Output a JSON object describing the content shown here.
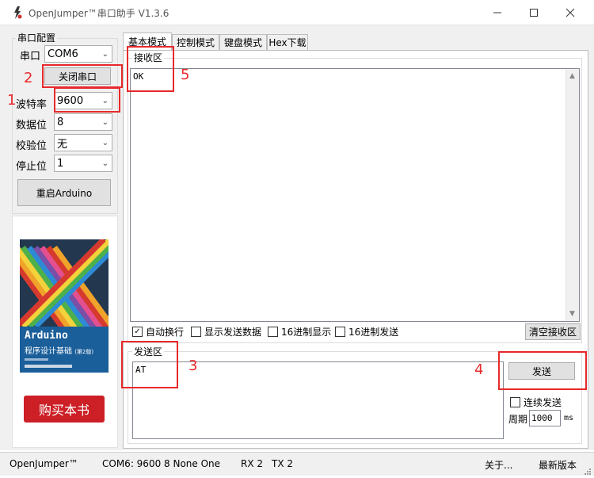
{
  "window": {
    "title": "OpenJumper™串口助手  V1.3.6",
    "icon": "openjumper-icon",
    "controls": [
      "minimize",
      "maximize",
      "close"
    ]
  },
  "serial_config": {
    "group_label": "串口配置",
    "port": {
      "label": "串口",
      "value": "COM6"
    },
    "close_port_button": "关闭串口",
    "baud": {
      "label": "波特率",
      "value": "9600"
    },
    "data_bits": {
      "label": "数据位",
      "value": "8"
    },
    "parity": {
      "label": "校验位",
      "value": "无"
    },
    "stop_bits": {
      "label": "停止位",
      "value": "1"
    },
    "restart_button": "重启Arduino"
  },
  "book_ad": {
    "title_line1": "Arduino",
    "title_line2": "程序设计基础",
    "edition": "(第2版)",
    "buy_button": "购买本书"
  },
  "tabs": [
    "基本模式",
    "控制模式",
    "键盘模式",
    "Hex下载"
  ],
  "active_tab": 0,
  "receive": {
    "label": "接收区",
    "content": "OK",
    "clear_button": "清空接收区"
  },
  "options": [
    {
      "label": "自动换行",
      "checked": true
    },
    {
      "label": "显示发送数据",
      "checked": false
    },
    {
      "label": "16进制显示",
      "checked": false
    },
    {
      "label": "16进制发送",
      "checked": false
    }
  ],
  "send": {
    "label": "发送区",
    "content": "AT",
    "send_button": "发送",
    "continuous_label": "连续发送",
    "continuous_checked": false,
    "period_label": "周期",
    "period_value": "1000",
    "period_unit": "ms"
  },
  "annotations": [
    "1",
    "2",
    "3",
    "4",
    "5"
  ],
  "annotation_color": "#e8292b",
  "status_bar": {
    "brand": "OpenJumper™",
    "port_info": "COM6: 9600 8 None One",
    "rx": "RX  2",
    "tx": "TX  2",
    "about": "关于...",
    "latest": "最新版本"
  }
}
